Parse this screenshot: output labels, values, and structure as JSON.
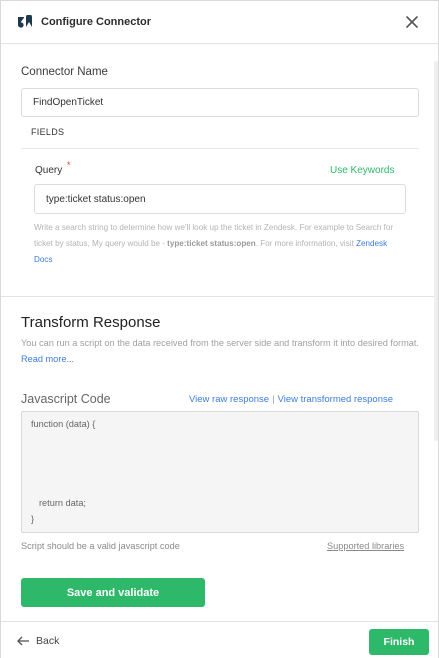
{
  "header": {
    "title": "Configure Connector",
    "logo_icon": "zendesk-logo",
    "close_icon": "close-icon"
  },
  "connector": {
    "name_label": "Connector Name",
    "name_value": "FindOpenTicket",
    "fields_label": "FIELDS"
  },
  "query": {
    "label": "Query",
    "required_mark": "*",
    "keywords_link": "Use Keywords",
    "value": "type:ticket status:open",
    "help_part1": "Write a search string to determine how we'll look up the ticket in Zendesk. For example to Search for ticket by status, My query would be - ",
    "help_example": "type:ticket status:open",
    "help_part2": ". For more information, visit ",
    "help_link": "Zendesk Docs"
  },
  "transform": {
    "title": "Transform Response",
    "description": "You can run a script on the data received from the server side and transform it into desired format. ",
    "read_more": "Read more...",
    "js_label": "Javascript Code",
    "view_raw": "View raw response",
    "separator": "|",
    "view_transformed": "View transformed response",
    "code_line1": "function (data) {",
    "code_line2": "return data;",
    "code_line3": "}",
    "script_note": "Script should be a valid javascript code",
    "supported_libraries": "Supported libraries",
    "save_button": "Save and validate"
  },
  "footer": {
    "back_label": "Back",
    "finish_label": "Finish"
  },
  "colors": {
    "accent_green": "#2db86a",
    "link_blue": "#3b7ddd",
    "required_red": "#e53935"
  }
}
